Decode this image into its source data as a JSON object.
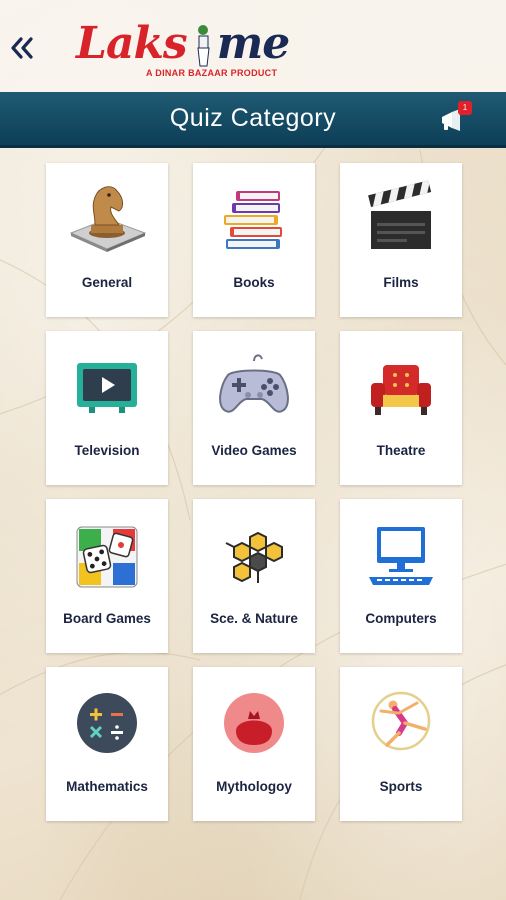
{
  "header": {
    "logo_text_a": "Laks",
    "logo_text_b": "me",
    "logo_tagline": "A DINAR BAZAAR PRODUCT",
    "title": "Quiz Category",
    "notification_count": "1"
  },
  "categories": [
    {
      "label": "General",
      "icon": "chess-knight-icon"
    },
    {
      "label": "Books",
      "icon": "books-stack-icon"
    },
    {
      "label": "Films",
      "icon": "clapperboard-icon"
    },
    {
      "label": "Television",
      "icon": "television-icon"
    },
    {
      "label": "Video Games",
      "icon": "gamepad-icon"
    },
    {
      "label": "Theatre",
      "icon": "theatre-seat-icon"
    },
    {
      "label": "Board Games",
      "icon": "board-game-dice-icon"
    },
    {
      "label": "Sce. & Nature",
      "icon": "molecule-hexagon-icon"
    },
    {
      "label": "Computers",
      "icon": "computer-icon"
    },
    {
      "label": "Mathematics",
      "icon": "math-operators-icon"
    },
    {
      "label": "Mythologoy",
      "icon": "pomegranate-icon"
    },
    {
      "label": "Sports",
      "icon": "gymnast-icon"
    }
  ],
  "colors": {
    "title_bar": "#1f5a73",
    "logo_red": "#d8232a",
    "logo_navy": "#1b2a54",
    "label_text": "#1b2440"
  }
}
